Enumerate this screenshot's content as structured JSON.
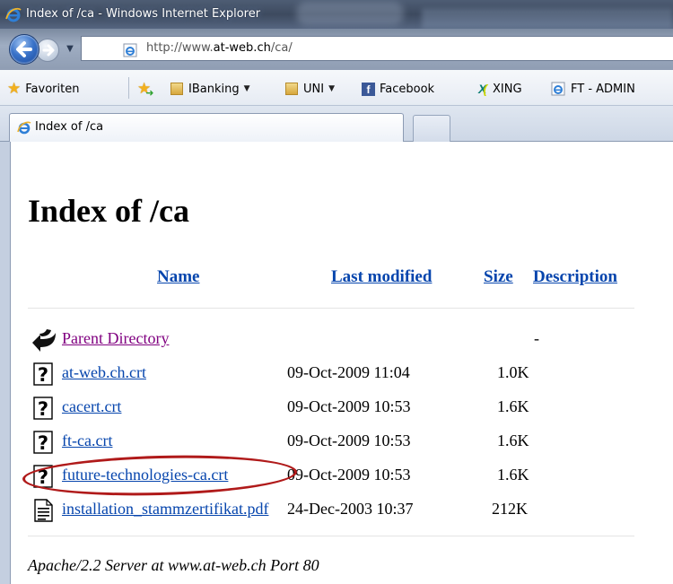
{
  "window": {
    "title": "Index of /ca - Windows Internet Explorer"
  },
  "navigation": {
    "address_prefix": "http://www.",
    "address_domain": "at-web.ch",
    "address_suffix": "/ca/"
  },
  "favorites": {
    "items": [
      {
        "label": "Favoriten",
        "icon": "star-icon"
      },
      {
        "label": "IBanking",
        "icon": "folder-icon",
        "dropdown": true
      },
      {
        "label": "UNI",
        "icon": "folder-icon",
        "dropdown": true
      },
      {
        "label": "Facebook",
        "icon": "facebook-icon"
      },
      {
        "label": "XING",
        "icon": "xing-icon"
      },
      {
        "label": "FT - ADMIN",
        "icon": "ie-page-icon"
      }
    ]
  },
  "tabs": {
    "active_label": "Index of /ca"
  },
  "page": {
    "title": "Index of /ca",
    "columns": {
      "name": "Name",
      "last_modified": "Last modified",
      "size": "Size",
      "description": "Description"
    },
    "rows": [
      {
        "name": "Parent Directory",
        "date": "",
        "size": "-",
        "icon": "back-arrow-icon",
        "visited": true
      },
      {
        "name": "at-web.ch.crt",
        "date": "09-Oct-2009 11:04",
        "size": "1.0K",
        "icon": "unknown-file-icon"
      },
      {
        "name": "cacert.crt",
        "date": "09-Oct-2009 10:53",
        "size": "1.6K",
        "icon": "unknown-file-icon"
      },
      {
        "name": "ft-ca.crt",
        "date": "09-Oct-2009 10:53",
        "size": "1.6K",
        "icon": "unknown-file-icon"
      },
      {
        "name": "future-technologies-ca.crt",
        "date": "09-Oct-2009 10:53",
        "size": "1.6K",
        "icon": "unknown-file-icon",
        "highlighted": true
      },
      {
        "name": "installation_stammzertifikat.pdf",
        "date": "24-Dec-2003 10:37",
        "size": "212K",
        "icon": "document-icon"
      }
    ],
    "footer": "Apache/2.2 Server at www.at-web.ch Port 80"
  },
  "colors": {
    "link": "#0645ad",
    "visited_link": "#800080",
    "highlight": "#b01a1a"
  }
}
